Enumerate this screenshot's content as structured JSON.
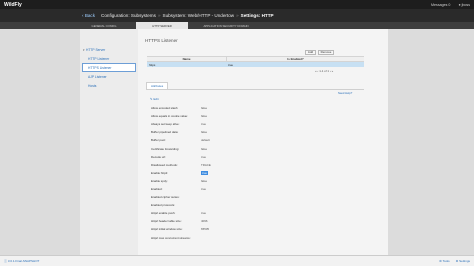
{
  "topbar": {
    "brand_main": "Wild",
    "brand_accent": "Fly",
    "messages": "Messages 0",
    "user": "jboss"
  },
  "breadcrumb": {
    "back": "Back",
    "items": [
      "Configuration: Subsystems",
      "Subsystem: Web/HTTP - Undertow"
    ],
    "current": "Settings: HTTP"
  },
  "tabs": [
    "GENERAL CONFIG",
    "HTTP SERVER",
    "APPLICATION SECURITY DOMAIN"
  ],
  "sidebar": {
    "root": "HTTP Server",
    "items": [
      "HTTP Listener",
      "HTTPS Listener",
      "AJP Listener",
      "Hosts"
    ]
  },
  "listener": {
    "title": "HTTPS Listener",
    "add_label": "Add",
    "remove_label": "Remove",
    "columns": [
      "Name",
      "Is Enabled?"
    ],
    "rows": [
      {
        "name": "https",
        "enabled": "true"
      }
    ],
    "pager": "1-1 of 1"
  },
  "attributes": {
    "tab_label": "Attributes",
    "need_help": "Need Help?",
    "edit_label": "Edit",
    "rows": [
      {
        "label": "Allow encoded slash:",
        "value": "false",
        "highlight": false
      },
      {
        "label": "Allow equals in cookie value:",
        "value": "false",
        "highlight": false
      },
      {
        "label": "Always set keep alive:",
        "value": "true",
        "highlight": false
      },
      {
        "label": "Buffer pipelined data:",
        "value": "false",
        "highlight": false
      },
      {
        "label": "Buffer pool:",
        "value": "default",
        "highlight": false
      },
      {
        "label": "Certificate forwarding:",
        "value": "false",
        "highlight": false
      },
      {
        "label": "Decode url:",
        "value": "true",
        "highlight": false
      },
      {
        "label": "Disallowed methods:",
        "value": "TRACE",
        "highlight": false
      },
      {
        "label": "Enable http2:",
        "value": "true",
        "highlight": true
      },
      {
        "label": "Enable spdy:",
        "value": "false",
        "highlight": false
      },
      {
        "label": "Enabled:",
        "value": "true",
        "highlight": false
      },
      {
        "label": "Enabled cipher suites:",
        "value": "",
        "highlight": false
      },
      {
        "label": "Enabled protocols:",
        "value": "",
        "highlight": false
      },
      {
        "label": "Http2 enable push:",
        "value": "true",
        "highlight": false
      },
      {
        "label": "Http2 header table size:",
        "value": "4096",
        "highlight": false
      },
      {
        "label": "Http2 initial window size:",
        "value": "65535",
        "highlight": false
      },
      {
        "label": "Http2 max concurrent streams:",
        "value": "",
        "highlight": false
      }
    ]
  },
  "footer": {
    "version": "3.0.1.Final-SNAPSHOT",
    "tools": "Tools",
    "settings": "Settings"
  }
}
